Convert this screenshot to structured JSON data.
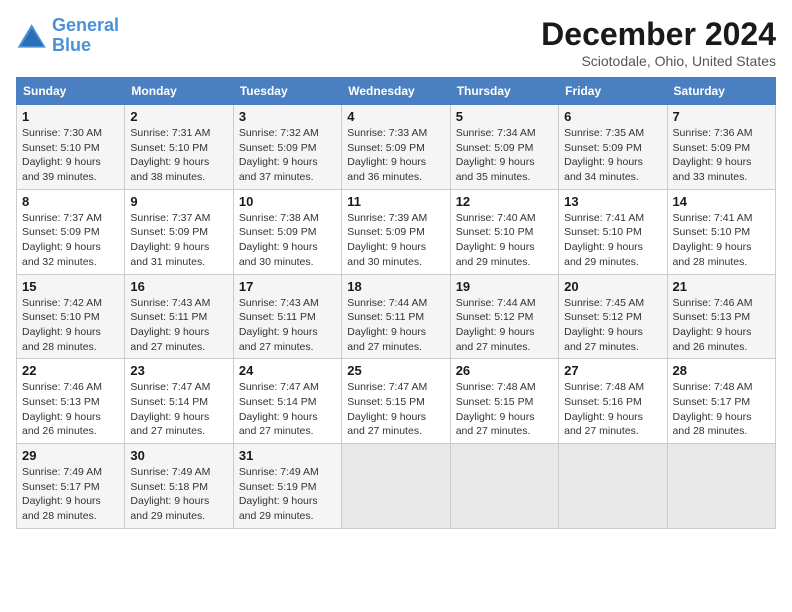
{
  "logo": {
    "line1": "General",
    "line2": "Blue"
  },
  "title": "December 2024",
  "location": "Sciotodale, Ohio, United States",
  "weekdays": [
    "Sunday",
    "Monday",
    "Tuesday",
    "Wednesday",
    "Thursday",
    "Friday",
    "Saturday"
  ],
  "weeks": [
    [
      {
        "day": "1",
        "sunrise": "Sunrise: 7:30 AM",
        "sunset": "Sunset: 5:10 PM",
        "daylight": "Daylight: 9 hours and 39 minutes."
      },
      {
        "day": "2",
        "sunrise": "Sunrise: 7:31 AM",
        "sunset": "Sunset: 5:10 PM",
        "daylight": "Daylight: 9 hours and 38 minutes."
      },
      {
        "day": "3",
        "sunrise": "Sunrise: 7:32 AM",
        "sunset": "Sunset: 5:09 PM",
        "daylight": "Daylight: 9 hours and 37 minutes."
      },
      {
        "day": "4",
        "sunrise": "Sunrise: 7:33 AM",
        "sunset": "Sunset: 5:09 PM",
        "daylight": "Daylight: 9 hours and 36 minutes."
      },
      {
        "day": "5",
        "sunrise": "Sunrise: 7:34 AM",
        "sunset": "Sunset: 5:09 PM",
        "daylight": "Daylight: 9 hours and 35 minutes."
      },
      {
        "day": "6",
        "sunrise": "Sunrise: 7:35 AM",
        "sunset": "Sunset: 5:09 PM",
        "daylight": "Daylight: 9 hours and 34 minutes."
      },
      {
        "day": "7",
        "sunrise": "Sunrise: 7:36 AM",
        "sunset": "Sunset: 5:09 PM",
        "daylight": "Daylight: 9 hours and 33 minutes."
      }
    ],
    [
      {
        "day": "8",
        "sunrise": "Sunrise: 7:37 AM",
        "sunset": "Sunset: 5:09 PM",
        "daylight": "Daylight: 9 hours and 32 minutes."
      },
      {
        "day": "9",
        "sunrise": "Sunrise: 7:37 AM",
        "sunset": "Sunset: 5:09 PM",
        "daylight": "Daylight: 9 hours and 31 minutes."
      },
      {
        "day": "10",
        "sunrise": "Sunrise: 7:38 AM",
        "sunset": "Sunset: 5:09 PM",
        "daylight": "Daylight: 9 hours and 30 minutes."
      },
      {
        "day": "11",
        "sunrise": "Sunrise: 7:39 AM",
        "sunset": "Sunset: 5:09 PM",
        "daylight": "Daylight: 9 hours and 30 minutes."
      },
      {
        "day": "12",
        "sunrise": "Sunrise: 7:40 AM",
        "sunset": "Sunset: 5:10 PM",
        "daylight": "Daylight: 9 hours and 29 minutes."
      },
      {
        "day": "13",
        "sunrise": "Sunrise: 7:41 AM",
        "sunset": "Sunset: 5:10 PM",
        "daylight": "Daylight: 9 hours and 29 minutes."
      },
      {
        "day": "14",
        "sunrise": "Sunrise: 7:41 AM",
        "sunset": "Sunset: 5:10 PM",
        "daylight": "Daylight: 9 hours and 28 minutes."
      }
    ],
    [
      {
        "day": "15",
        "sunrise": "Sunrise: 7:42 AM",
        "sunset": "Sunset: 5:10 PM",
        "daylight": "Daylight: 9 hours and 28 minutes."
      },
      {
        "day": "16",
        "sunrise": "Sunrise: 7:43 AM",
        "sunset": "Sunset: 5:11 PM",
        "daylight": "Daylight: 9 hours and 27 minutes."
      },
      {
        "day": "17",
        "sunrise": "Sunrise: 7:43 AM",
        "sunset": "Sunset: 5:11 PM",
        "daylight": "Daylight: 9 hours and 27 minutes."
      },
      {
        "day": "18",
        "sunrise": "Sunrise: 7:44 AM",
        "sunset": "Sunset: 5:11 PM",
        "daylight": "Daylight: 9 hours and 27 minutes."
      },
      {
        "day": "19",
        "sunrise": "Sunrise: 7:44 AM",
        "sunset": "Sunset: 5:12 PM",
        "daylight": "Daylight: 9 hours and 27 minutes."
      },
      {
        "day": "20",
        "sunrise": "Sunrise: 7:45 AM",
        "sunset": "Sunset: 5:12 PM",
        "daylight": "Daylight: 9 hours and 27 minutes."
      },
      {
        "day": "21",
        "sunrise": "Sunrise: 7:46 AM",
        "sunset": "Sunset: 5:13 PM",
        "daylight": "Daylight: 9 hours and 26 minutes."
      }
    ],
    [
      {
        "day": "22",
        "sunrise": "Sunrise: 7:46 AM",
        "sunset": "Sunset: 5:13 PM",
        "daylight": "Daylight: 9 hours and 26 minutes."
      },
      {
        "day": "23",
        "sunrise": "Sunrise: 7:47 AM",
        "sunset": "Sunset: 5:14 PM",
        "daylight": "Daylight: 9 hours and 27 minutes."
      },
      {
        "day": "24",
        "sunrise": "Sunrise: 7:47 AM",
        "sunset": "Sunset: 5:14 PM",
        "daylight": "Daylight: 9 hours and 27 minutes."
      },
      {
        "day": "25",
        "sunrise": "Sunrise: 7:47 AM",
        "sunset": "Sunset: 5:15 PM",
        "daylight": "Daylight: 9 hours and 27 minutes."
      },
      {
        "day": "26",
        "sunrise": "Sunrise: 7:48 AM",
        "sunset": "Sunset: 5:15 PM",
        "daylight": "Daylight: 9 hours and 27 minutes."
      },
      {
        "day": "27",
        "sunrise": "Sunrise: 7:48 AM",
        "sunset": "Sunset: 5:16 PM",
        "daylight": "Daylight: 9 hours and 27 minutes."
      },
      {
        "day": "28",
        "sunrise": "Sunrise: 7:48 AM",
        "sunset": "Sunset: 5:17 PM",
        "daylight": "Daylight: 9 hours and 28 minutes."
      }
    ],
    [
      {
        "day": "29",
        "sunrise": "Sunrise: 7:49 AM",
        "sunset": "Sunset: 5:17 PM",
        "daylight": "Daylight: 9 hours and 28 minutes."
      },
      {
        "day": "30",
        "sunrise": "Sunrise: 7:49 AM",
        "sunset": "Sunset: 5:18 PM",
        "daylight": "Daylight: 9 hours and 29 minutes."
      },
      {
        "day": "31",
        "sunrise": "Sunrise: 7:49 AM",
        "sunset": "Sunset: 5:19 PM",
        "daylight": "Daylight: 9 hours and 29 minutes."
      },
      null,
      null,
      null,
      null
    ]
  ]
}
